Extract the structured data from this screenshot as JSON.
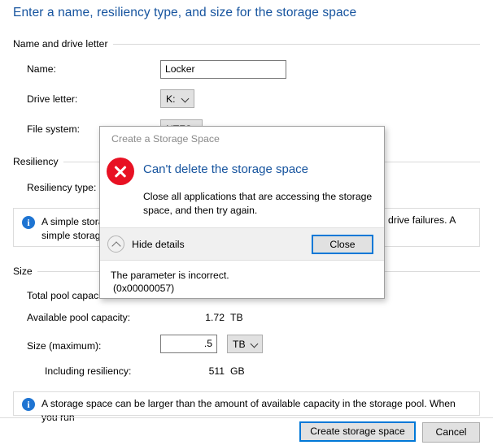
{
  "wizard": {
    "page_title": "Enter a name, resiliency type, and size for the storage space",
    "groups": {
      "name_and_drive_letter": "Name and drive letter",
      "resiliency": "Resiliency",
      "size": "Size"
    },
    "fields": {
      "name_label": "Name:",
      "name_value": "Locker",
      "drive_letter_label": "Drive letter:",
      "drive_letter_value": "K:",
      "file_system_label": "File system:",
      "file_system_value": "NTFS",
      "resiliency_type_label": "Resiliency type:"
    },
    "resiliency_info": {
      "icon": "info-icon",
      "text_left": "A simple storage",
      "text_left_line2": "simple storage s",
      "text_right": "drive failures. A"
    },
    "size": {
      "total_pool_label": "Total pool capacit",
      "available_pool_label": "Available pool capacity:",
      "available_pool_value": "1.72",
      "available_pool_unit": "TB",
      "size_max_label": "Size (maximum):",
      "size_max_value": ".5",
      "size_max_unit": "TB",
      "including_resiliency_label": "Including resiliency:",
      "including_resiliency_value": "511",
      "including_resiliency_unit": "GB"
    },
    "footer_info": {
      "icon": "info-icon",
      "text": "A storage space can be larger than the amount of available capacity in the storage pool. When you run"
    },
    "buttons": {
      "create": "Create storage space",
      "cancel": "Cancel"
    }
  },
  "dialog": {
    "title": "Create a Storage Space",
    "icon": "error-icon",
    "heading": "Can't delete the storage space",
    "body": "Close all applications that are accessing the storage space, and then try again.",
    "hide_details_label": "Hide details",
    "hide_details_icon": "chevron-up-icon",
    "close_button": "Close",
    "details_line1": "The parameter is incorrect.",
    "details_line2": "(0x00000057)"
  },
  "colors": {
    "title_blue": "#15539e",
    "error_red": "#e81123",
    "focus_blue": "#0078d7",
    "info_blue": "#1e74d2"
  }
}
